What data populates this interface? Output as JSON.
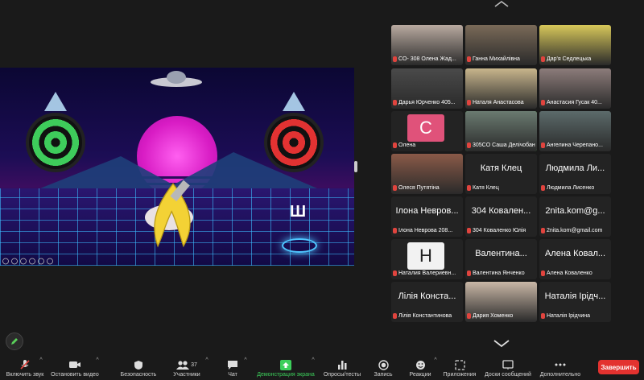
{
  "shared_screen": {
    "overlay_letter": "Ш"
  },
  "gallery": {
    "tiles": [
      {
        "caption": "CO- 308 Олена Жад...",
        "big": "",
        "type": "photo",
        "color": "#b9aaa0"
      },
      {
        "caption": "Ганна Михайлівна",
        "big": "",
        "type": "photo",
        "color": "#7a6a58"
      },
      {
        "caption": "Дар'я Седлецька",
        "big": "",
        "type": "photo",
        "color": "#d8c85a"
      },
      {
        "caption": "Дарья Юрченко 405...",
        "big": "",
        "type": "photo",
        "color": "#4a4a4a"
      },
      {
        "caption": "Наталя Анастасова",
        "big": "",
        "type": "photo",
        "color": "#c8b58c"
      },
      {
        "caption": "Анастасия Гусак 40...",
        "big": "",
        "type": "photo",
        "color": "#8c7c7a"
      },
      {
        "caption": "Олена",
        "big": "C",
        "type": "avatar",
        "color": "#e0527a"
      },
      {
        "caption": "305CO Саша Делічобан",
        "big": "",
        "type": "photo",
        "color": "#6a7a70",
        "active": true
      },
      {
        "caption": "Ангелина Черепано...",
        "big": "",
        "type": "photo",
        "color": "#5c6a6a"
      },
      {
        "caption": "Олеся Путятіна",
        "big": "",
        "type": "photo",
        "color": "#8a5a48"
      },
      {
        "caption": "Катя Клец",
        "big": "Катя Клец",
        "type": "name"
      },
      {
        "caption": "Людмила Лисенко",
        "big": "Людмила Ли...",
        "type": "name"
      },
      {
        "caption": "Ілона Неврова 208...",
        "big": "Ілона Невров...",
        "type": "name"
      },
      {
        "caption": "304 Коваленко Юлія",
        "big": "304 Ковален...",
        "type": "name"
      },
      {
        "caption": "2nita.kom@gmail.com",
        "big": "2nita.kom@g...",
        "type": "name"
      },
      {
        "caption": "Наталия Валериевн...",
        "big": "H",
        "type": "avatar",
        "color": "#f2f2f2"
      },
      {
        "caption": "Валентина Янченко",
        "big": "Валентина...",
        "type": "name"
      },
      {
        "caption": "Алена Коваленко",
        "big": "Алена Ковал...",
        "type": "name"
      },
      {
        "caption": "Лілія Константинова",
        "big": "Лілія Конста...",
        "type": "name"
      },
      {
        "caption": "Дария Хоменко",
        "big": "",
        "type": "photo",
        "color": "#c9b7a6"
      },
      {
        "caption": "Наталія Ірідчина",
        "big": "Наталія Ірідч...",
        "type": "name"
      }
    ]
  },
  "toolbar": {
    "mute": "Включить звук",
    "video": "Остановить видео",
    "security": "Безопасность",
    "participants": "Участники",
    "participants_count": "37",
    "chat": "Чат",
    "share": "Демонстрация экрана",
    "polls": "Опросы/тесты",
    "record": "Запись",
    "reactions": "Реакции",
    "apps": "Приложения",
    "whiteboards": "Доски сообщений",
    "more": "Дополнительно",
    "end": "Завершить"
  },
  "colors": {
    "share_green": "#3ccf5b",
    "end_red": "#e3322f",
    "active_border": "#5ad15a",
    "mic_muted": "#e0443e"
  }
}
